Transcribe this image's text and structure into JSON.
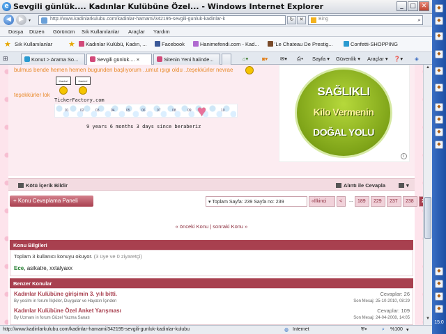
{
  "window": {
    "title": "Sevgili günlük.... Kadınlar Kulübüne Özel... - Windows Internet Explorer",
    "controls": [
      "_",
      "□",
      "✕"
    ]
  },
  "address": {
    "url": "http://www.kadinlarkulubu.com/kadinlar-hamami/342195-sevgili-gunluk-kadinlar-k",
    "search_placeholder": "Bing"
  },
  "menu": [
    "Dosya",
    "Düzen",
    "Görünüm",
    "Sık Kullanılanlar",
    "Araçlar",
    "Yardım"
  ],
  "favorites": {
    "label": "Sık Kullanılanlar",
    "links": [
      {
        "label": "Kadınlar Kulübü, Kadın, ...",
        "color": "#d24a7a"
      },
      {
        "label": "Facebook",
        "color": "#3b5998"
      },
      {
        "label": "Hanimefendi.com - Kad...",
        "color": "#b06ad0"
      },
      {
        "label": "'Le Chateau De Prestig...",
        "color": "#7a4b2a"
      },
      {
        "label": "Confetti-SHOPPING",
        "color": "#2a9ad0"
      }
    ]
  },
  "tabs": [
    {
      "label": "Konut > Arama So..."
    },
    {
      "label": "Sevgili günlük.... ×"
    },
    {
      "label": "Sitenin Yeni halinde..."
    }
  ],
  "tab_tools": {
    "page": "Sayfa ▾",
    "safety": "Güvenlik ▾",
    "tools": "Araçlar ▾",
    "help": "❓▾"
  },
  "post": {
    "line1": "bulmus bende hemen hemen bugunden başlıyorum ..umut ışıgı oldu ..teşekkürler nevrae",
    "line2": "teşekkürler lok",
    "sign_text": "thanks!",
    "ticker_label": "TickerFactory.com",
    "ticker_numbers": [
      "01",
      "02",
      "03",
      "04",
      "05",
      "06",
      "07",
      "08",
      "09",
      "10"
    ],
    "since": "9 years 6 months 3 days since beraberiz"
  },
  "ad": {
    "line1": "SAĞLIKLI",
    "line2": "Kilo Vermenin",
    "line3": "DOĞAL YOLU",
    "info": "i"
  },
  "post_footer": {
    "report": "Kötü İçerik Bildir",
    "quote": "Alıntı ile Cevapla",
    "more": "▾"
  },
  "reply_panel": "+ Konu Cevaplama Paneli",
  "pagination": {
    "summary": "▾ Toplam Sayfa: 239 Sayfa no: 239",
    "first": "«İlkinci",
    "prev": "<",
    "ellipsis": "...",
    "pages": [
      "189",
      "229",
      "237",
      "238"
    ],
    "current": "239"
  },
  "thread_nav": "« önceki Konu | sonraki Konu »",
  "info_panel": {
    "title": "Konu Bilgileri",
    "users_reading": "Toplam 3 kullanıcı konuyu okuyor.",
    "users_breakdown": "(3 üye ve 0 ziyaretçi)",
    "names": [
      "Ece",
      "asikatre",
      "xxtalyaxx"
    ]
  },
  "similar": {
    "title": "Benzer Konular",
    "items": [
      {
        "title": "Kadınlar Kulübüne girişimin 3. yılı bitti.",
        "subtitle": "By yesilm in forum İlişkiler, Duygular ve Hayatın İçinden",
        "replies": "Cevaplar: 26",
        "last": "Son Mesaj: 25-10-2010, 08:29"
      },
      {
        "title": "Kadınlar Kulübüne Özel Anket Yarışması",
        "subtitle": "By Uzmanı in forum Güzel Yazma Sanatı",
        "replies": "Cevaplar: 109",
        "last": "Son Mesaj: 24-04-2008, 14:05"
      }
    ]
  },
  "status": {
    "url": "http://www.kadinlarkulubu.com/kadinlar-hamami/342195-sevgili-gunluk-kadinlar-kulubu",
    "zone": "Internet",
    "zoom": "%100"
  },
  "clock": "15:0"
}
